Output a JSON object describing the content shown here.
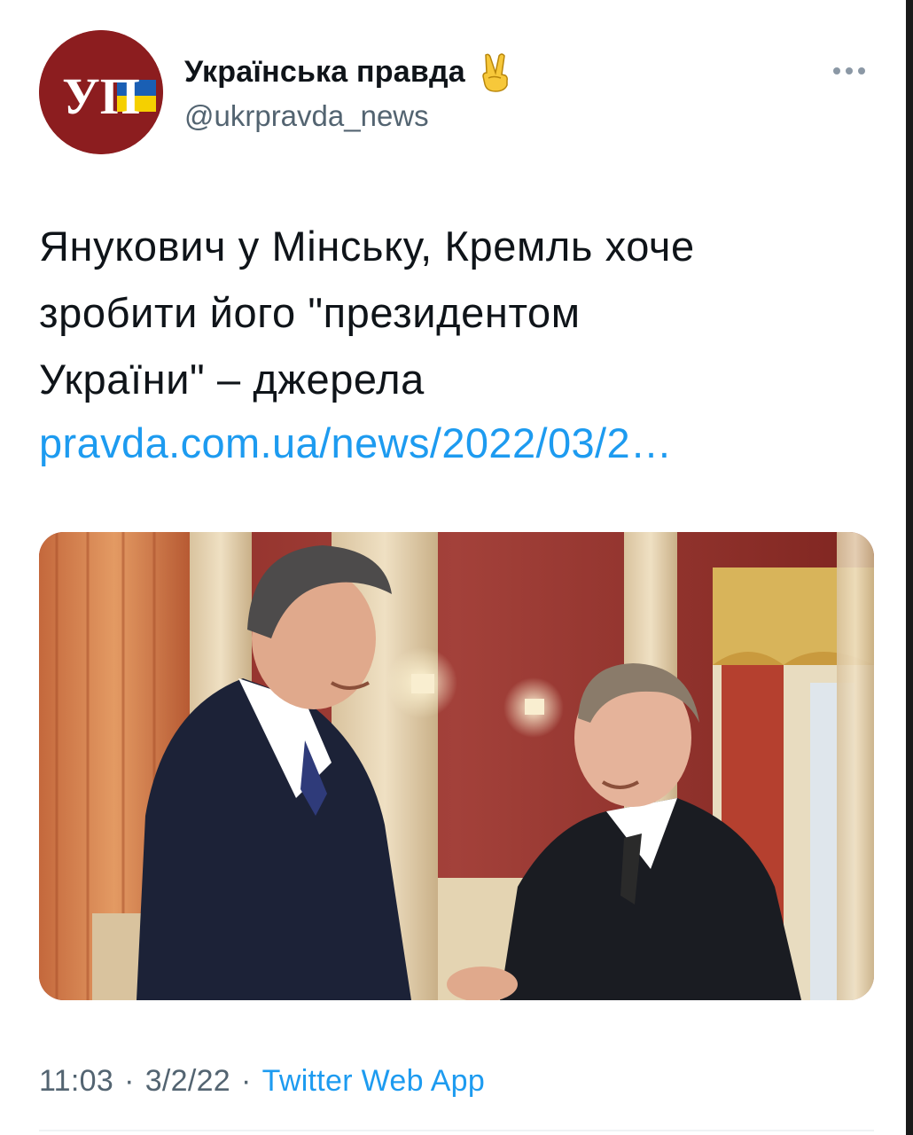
{
  "tweet": {
    "display_name": "Українська правда",
    "name_emoji": "✌️",
    "handle": "@ukrpravda_news",
    "avatar_text": "УП",
    "text_lines": [
      "Янукович у Мінську, Кремль хоче",
      "зробити його \"президентом",
      "України\" – джерела"
    ],
    "link": "pravda.com.ua/news/2022/03/2…",
    "time": "11:03",
    "date": "3/2/22",
    "separator": "·",
    "source": "Twitter Web App"
  },
  "icons": {
    "more": "more-horizontal-icon",
    "emoji": "victory-hand-icon",
    "avatar_flag": "ukraine-flag-icon"
  },
  "colors": {
    "link": "#1d9bf0",
    "secondary_text": "#536471",
    "avatar_bg": "#8c1d1f",
    "flag_blue": "#1a5fb4",
    "flag_yellow": "#f5d000"
  }
}
